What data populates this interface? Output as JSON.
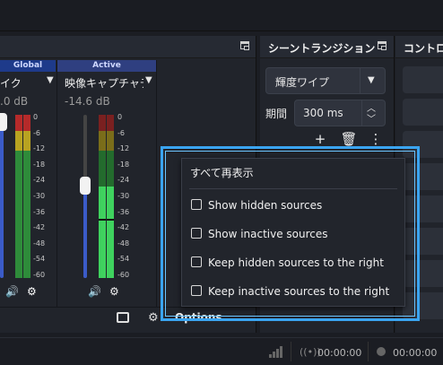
{
  "mixer": {
    "channels": [
      {
        "header": "Global",
        "name": "イク",
        "db": ".0 dB",
        "header_color": "#1e3a8a"
      },
      {
        "header": "Active",
        "name": "映像キャプチャデバイ",
        "db": "-14.6 dB",
        "header_color": "#2f3f80"
      }
    ],
    "ticks": [
      "0",
      "-6",
      "-12",
      "-18",
      "-24",
      "-30",
      "-36",
      "-42",
      "-48",
      "-54",
      "-60"
    ],
    "footer_options_label": "Options"
  },
  "transition": {
    "title": "シーントランジション",
    "selected": "輝度ワイプ",
    "duration_label": "期間",
    "duration_value": "300 ms"
  },
  "controls": {
    "title": "コントロー"
  },
  "status": {
    "time1": "00:00:00",
    "time2": "00:00:00"
  },
  "menu": {
    "show_all": "すべて再表示",
    "items": [
      {
        "label": "Show hidden sources",
        "checked": false
      },
      {
        "label": "Show inactive sources",
        "checked": false
      },
      {
        "label": "Keep hidden sources to the right",
        "checked": false
      },
      {
        "label": "Keep inactive sources to the right",
        "checked": false
      }
    ]
  },
  "colors": {
    "accent": "#3aa4f0",
    "meter_green": "#2ea84a",
    "meter_yellow": "#b8a321",
    "meter_red": "#b52a2a"
  }
}
